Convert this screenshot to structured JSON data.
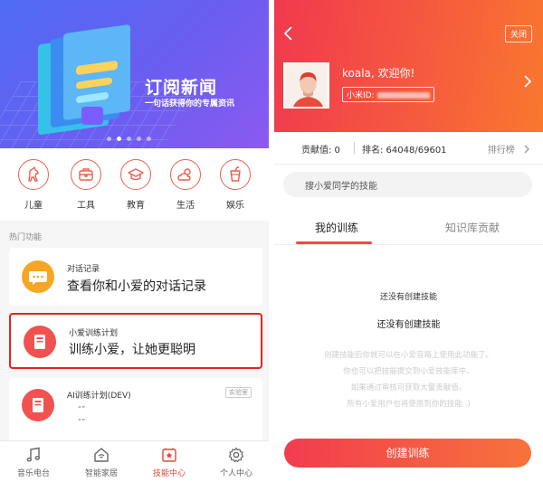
{
  "left": {
    "banner": {
      "title": "订阅新闻",
      "subtitle": "一句话获得你的专属资讯",
      "dot_count": 5,
      "active_dot": 1
    },
    "categories": [
      {
        "label": "儿童",
        "icon": "horse-icon"
      },
      {
        "label": "工具",
        "icon": "toolbox-icon"
      },
      {
        "label": "教育",
        "icon": "graduation-cap-icon"
      },
      {
        "label": "生活",
        "icon": "sun-cloud-icon"
      },
      {
        "label": "娱乐",
        "icon": "drink-icon"
      }
    ],
    "section_label": "热门功能",
    "cards": [
      {
        "title": "对话记录",
        "desc": "查看你和小爱的对话记录",
        "icon": "chat-bubble-icon",
        "color": "#f5a623"
      },
      {
        "title": "小爱训练计划",
        "desc": "训练小爱，让她更聪明",
        "icon": "book-icon",
        "color": "#f0524f",
        "highlighted": true
      },
      {
        "title": "AI训练计划(DEV)",
        "tag": "实验室",
        "lines": [
          "“”",
          "“”"
        ],
        "icon": "book-icon",
        "color": "#f0524f"
      }
    ],
    "tabbar": [
      {
        "label": "音乐电台",
        "icon": "music-note-icon"
      },
      {
        "label": "智能家居",
        "icon": "smart-home-icon"
      },
      {
        "label": "技能中心",
        "icon": "skill-star-icon",
        "active": true
      },
      {
        "label": "个人中心",
        "icon": "gear-icon"
      }
    ]
  },
  "right": {
    "close_label": "关闭",
    "user": {
      "greeting": "koala, 欢迎你!",
      "id_label": "小米ID:"
    },
    "stats": {
      "contribution": "贡献值: 0",
      "rank": "排名: 64048/69601",
      "rank_link": "排行榜"
    },
    "search_placeholder": "搜小爱同学的技能",
    "tabs": [
      "我的训练",
      "知识库贡献"
    ],
    "empty_small": "还没有创建技能",
    "empty_title": "还没有创建技能",
    "description": [
      "创建技能后你就可以在小爱音箱上使用此功能了。",
      "你也可以把技能提交到小爱技能库中。",
      "如果通过审核可获取大量贡献值。",
      "所有小爱用户也将使用到你的技能 :)"
    ],
    "create_button": "创建训练",
    "colors": {
      "accent": "#ef4b44",
      "gradient_start": "#f0394e",
      "gradient_end": "#f9782e"
    }
  }
}
